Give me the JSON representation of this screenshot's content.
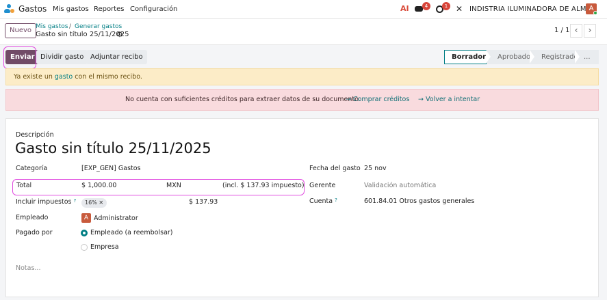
{
  "topbar": {
    "app_name": "Gastos",
    "menu": [
      "Mis gastos",
      "Reportes",
      "Configuración"
    ],
    "ai_label": "AI",
    "chat_badge": "4",
    "activity_badge": "1",
    "company": "INDISTRIA ILUMINADORA DE ALM...",
    "avatar_letter": "A"
  },
  "control_panel": {
    "new_label": "Nuevo",
    "breadcrumb": [
      "Mis gastos",
      "Generar gastos"
    ],
    "breadcrumb_sep": "/",
    "record_title": "Gasto sin título 25/11/2025",
    "pager": "1 / 1"
  },
  "actions": {
    "send": "Enviar",
    "split": "Dividir gasto",
    "attach": "Adjuntar recibo"
  },
  "statusbar": {
    "stages": [
      "Borrador",
      "Aprobado",
      "Registrado",
      "..."
    ],
    "active": "Borrador"
  },
  "alerts": {
    "warning_pre": "Ya existe un ",
    "warning_link": "gasto",
    "warning_post": " con el mismo recibo.",
    "error_text": "No cuenta con suficientes créditos para extraer datos de su documento.",
    "error_link_buy": "Comprar créditos",
    "error_link_retry": "Volver a intentar"
  },
  "form": {
    "description_label": "Descripción",
    "title": "Gasto sin título 25/11/2025",
    "category_label": "Categoría",
    "category_value": "[EXP_GEN] Gastos",
    "total_label": "Total",
    "total_value": "$ 1,000.00",
    "currency": "MXN",
    "tax_included": "(incl. $ 137.93 impuesto)",
    "taxes_label": "Incluir impuestos",
    "tax_tag": "16%",
    "tax_amount": "$ 137.93",
    "employee_label": "Empleado",
    "employee_avatar": "A",
    "employee_value": "Administrator",
    "paid_by_label": "Pagado por",
    "paid_by_options": [
      "Empleado (a reembolsar)",
      "Empresa"
    ],
    "paid_by_selected": "Empleado (a reembolsar)",
    "date_label": "Fecha del gasto",
    "date_value": "25 nov",
    "manager_label": "Gerente",
    "manager_value": "Validación automática",
    "account_label": "Cuenta",
    "account_value": "601.84.01 Otros gastos generales",
    "help_mark": "?",
    "notes_placeholder": "Notas..."
  },
  "colors": {
    "brand": "#714b67",
    "accent": "#017e84",
    "highlight": "#e14ce0",
    "warning_bg": "#fcecc7",
    "error_bg": "#f9dbde"
  }
}
